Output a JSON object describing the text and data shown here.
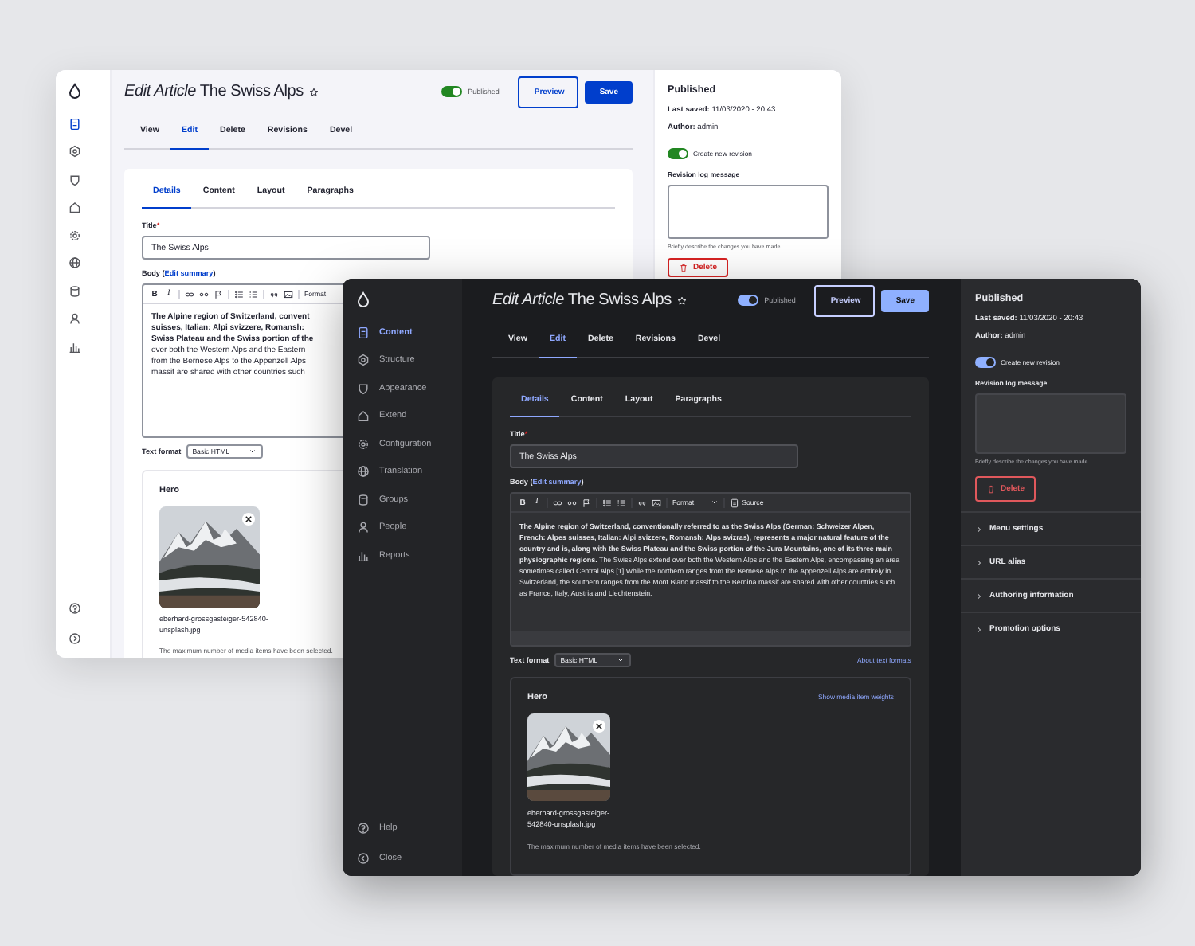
{
  "windows": [
    {
      "kind": "light",
      "nav": {
        "items": [
          {
            "selected": true
          },
          {
            "selected": false
          },
          {
            "selected": false
          },
          {
            "selected": false
          },
          {
            "selected": false
          },
          {
            "selected": false
          },
          {
            "selected": false
          },
          {
            "selected": false
          },
          {
            "selected": false
          }
        ]
      },
      "header": {
        "title": "*Edit Article* The Swiss Alps",
        "status": {
          "label": "Published",
          "on": true
        },
        "preview": "Preview",
        "save": "Save"
      },
      "tabs": [
        {
          "label": "View",
          "selected": false
        },
        {
          "label": "Edit",
          "selected": true
        },
        {
          "label": "Delete",
          "selected": false
        },
        {
          "label": "Revisions",
          "selected": false
        },
        {
          "label": "Devel",
          "selected": false
        }
      ],
      "form": {
        "subtabs": [
          {
            "label": "Details",
            "selected": true
          },
          {
            "label": "Content",
            "selected": false
          },
          {
            "label": "Layout",
            "selected": false
          },
          {
            "label": "Paragraphs",
            "selected": false
          }
        ],
        "title_field": {
          "label": "Title",
          "required_mark": "*",
          "value": "The Swiss Alps"
        },
        "body": {
          "label": "Body (",
          "link": "Edit summary",
          "label_end": ")",
          "toolbar": {
            "bold": "B",
            "italic": "I",
            "format": "Format"
          },
          "lines": [
            "**The Alpine region of Switzerland, convent**",
            "**suisses, Italian: Alpi svizzere, Romansh:**",
            "**Swiss Plateau and the Swiss portion of the**",
            "over both the Western Alps and the Eastern",
            "from the Bernese Alps to the Appenzell Alps",
            "massif are shared with other countries such"
          ]
        },
        "text_format": {
          "label": "Text format",
          "value": "Basic HTML"
        },
        "hero": {
          "title": "Hero",
          "media": {
            "filename": "eberhard-grossgasteiger-542840-unsplash.jpg"
          },
          "note": "The maximum number of media items have been selected."
        }
      },
      "sidebar": {
        "title": "Published",
        "last_saved": "**Last saved:** 11/03/2020 - 20:43",
        "author": "**Author:** admin",
        "revision": {
          "label": "Create new revision",
          "on": true
        },
        "log": {
          "label": "Revision log message",
          "help": "Briefly describe the changes you have made."
        },
        "delete": "Delete"
      }
    },
    {
      "kind": "dark",
      "nav": {
        "items": [
          {
            "label": "Content",
            "selected": true
          },
          {
            "label": "Structure",
            "selected": false
          },
          {
            "label": "Appearance",
            "selected": false
          },
          {
            "label": "Extend",
            "selected": false
          },
          {
            "label": "Configuration",
            "selected": false
          },
          {
            "label": "Translation",
            "selected": false
          },
          {
            "label": "Groups",
            "selected": false
          },
          {
            "label": "People",
            "selected": false
          },
          {
            "label": "Reports",
            "selected": false
          }
        ],
        "footer": [
          "Help",
          "Close"
        ]
      },
      "header": {
        "title": "*Edit Article* The Swiss Alps",
        "status": {
          "label": "Published",
          "on": true
        },
        "preview": "Preview",
        "save": "Save"
      },
      "tabs": [
        {
          "label": "View",
          "selected": false
        },
        {
          "label": "Edit",
          "selected": true
        },
        {
          "label": "Delete",
          "selected": false
        },
        {
          "label": "Revisions",
          "selected": false
        },
        {
          "label": "Devel",
          "selected": false
        }
      ],
      "form": {
        "subtabs": [
          {
            "label": "Details",
            "selected": true
          },
          {
            "label": "Content",
            "selected": false
          },
          {
            "label": "Layout",
            "selected": false
          },
          {
            "label": "Paragraphs",
            "selected": false
          }
        ],
        "title_field": {
          "label": "Title",
          "required_mark": "*",
          "value": "The Swiss Alps"
        },
        "body": {
          "label": "Body (",
          "link": "Edit summary",
          "label_end": ")",
          "toolbar": {
            "bold": "B",
            "italic": "I",
            "format": "Format",
            "source": "Source"
          },
          "text": "**The Alpine region of Switzerland, conventionally referred to as the Swiss Alps (German: Schweizer Alpen, French: Alpes suisses, Italian: Alpi svizzere, Romansh: Alps svizras), represents a major natural feature of the country and is, along with the Swiss Plateau and the Swiss portion of the Jura Mountains, one of its three main physiographic regions.** The Swiss Alps extend over both the Western Alps and the Eastern Alps, encompassing an area sometimes called Central Alps.[1] While the northern ranges from the Bernese Alps to the Appenzell Alps are entirely in Switzerland, the southern ranges from the Mont Blanc massif to the Bernina massif are shared with other countries such as France, Italy, Austria and Liechtenstein."
        },
        "text_format": {
          "label": "Text format",
          "value": "Basic HTML",
          "link": "About text formats"
        },
        "hero": {
          "title": "Hero",
          "link": "Show media item weights",
          "media": {
            "filename": "eberhard-grossgasteiger-542840-unsplash.jpg"
          },
          "note": "The maximum number of media items have been selected."
        }
      },
      "sidebar": {
        "title": "Published",
        "last_saved": "**Last saved:** 11/03/2020 - 20:43",
        "author": "**Author:** admin",
        "revision": {
          "label": "Create new revision",
          "on": true
        },
        "log": {
          "label": "Revision log message",
          "help": "Briefly describe the changes you have made."
        },
        "delete": "Delete",
        "sections": [
          "Menu settings",
          "URL alias",
          "Authoring information",
          "Promotion options"
        ]
      }
    }
  ]
}
